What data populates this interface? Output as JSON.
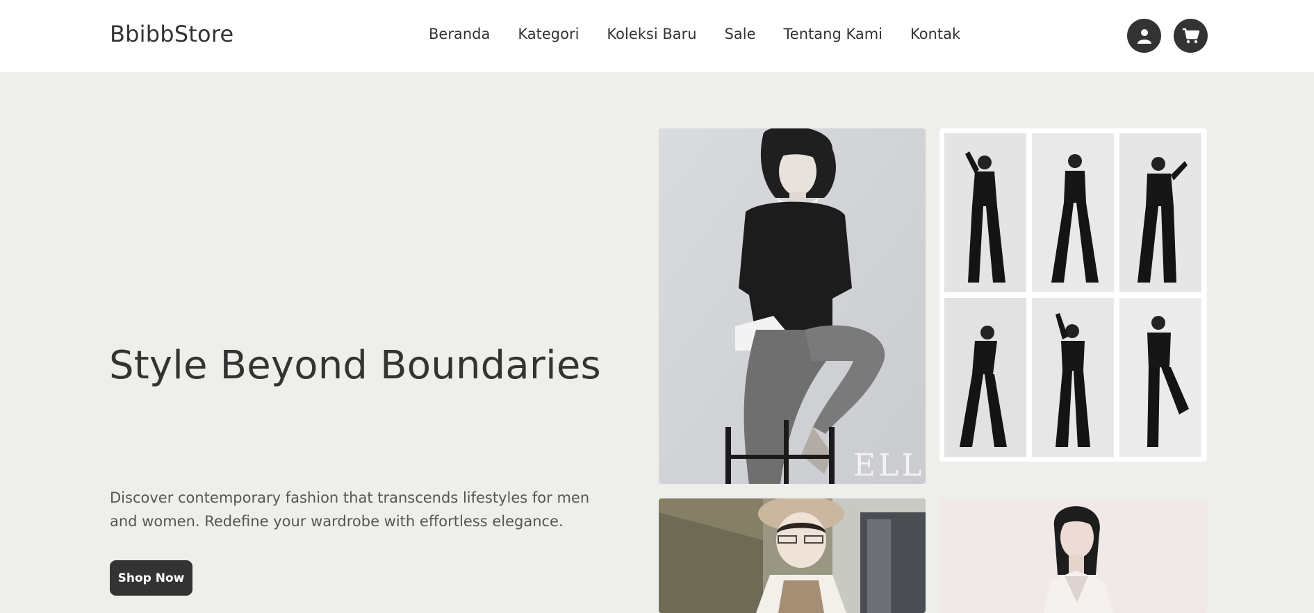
{
  "brand": "BbibbStore",
  "nav": {
    "items": [
      "Beranda",
      "Kategori",
      "Koleksi Baru",
      "Sale",
      "Tentang Kami",
      "Kontak"
    ]
  },
  "header_icons": [
    "user-icon",
    "cart-icon"
  ],
  "hero": {
    "title": "Style Beyond Boundaries",
    "description": "Discover contemporary fashion that transcends lifestyles for men and women. Redefine your wardrobe with effortless elegance.",
    "cta_label": "Shop Now"
  },
  "gallery": {
    "main_logo_text": "ELLE"
  },
  "colors": {
    "dark": "#333333",
    "hero_bg": "#eeeeea",
    "header_bg": "#ffffff"
  }
}
